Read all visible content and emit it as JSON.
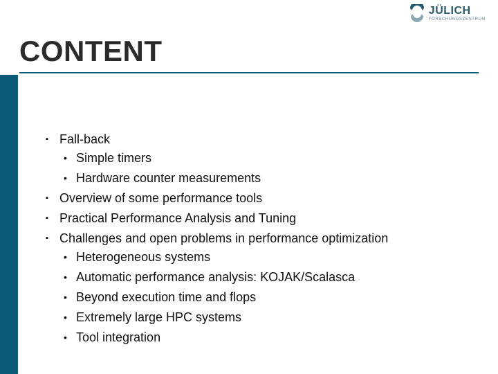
{
  "logo": {
    "name": "JÜLICH",
    "subtitle": "FORSCHUNGSZENTRUM"
  },
  "title": "CONTENT",
  "colors": {
    "accent": "#0b5a77",
    "text": "#101010",
    "logo_primary": "#1f5a70",
    "logo_secondary": "#8aa9b2"
  },
  "bullets": [
    {
      "text": "Fall-back",
      "children": [
        "Simple timers",
        "Hardware counter measurements"
      ]
    },
    {
      "text": "Overview of some performance tools"
    },
    {
      "text": "Practical Performance Analysis and Tuning"
    },
    {
      "text": "Challenges and open problems in performance optimization",
      "children": [
        "Heterogeneous systems",
        "Automatic performance analysis: KOJAK/Scalasca",
        "Beyond execution time and flops",
        "Extremely large HPC systems",
        "Tool integration"
      ]
    }
  ]
}
